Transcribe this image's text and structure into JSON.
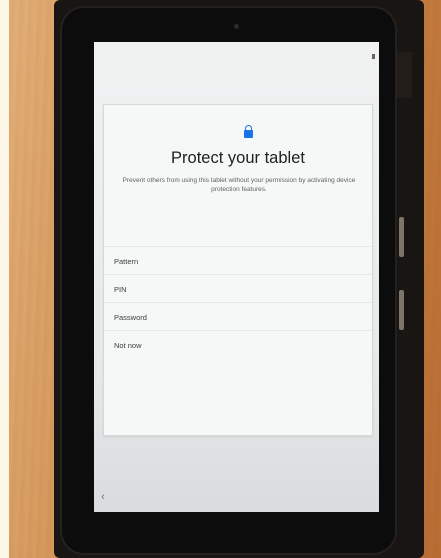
{
  "screen": {
    "title": "Protect your tablet",
    "description": "Prevent others from using this tablet without your permission by activating device protection features.",
    "options": [
      {
        "label": "Pattern"
      },
      {
        "label": "PIN"
      },
      {
        "label": "Password"
      },
      {
        "label": "Not now"
      }
    ],
    "lock_icon": "lock-icon",
    "back_icon": "back-chevron-icon"
  },
  "colors": {
    "accent": "#1a73e8",
    "screen_bg": "#eef0f0",
    "device_body": "#0d0c0c",
    "background_wood": "#cc8a4c"
  }
}
